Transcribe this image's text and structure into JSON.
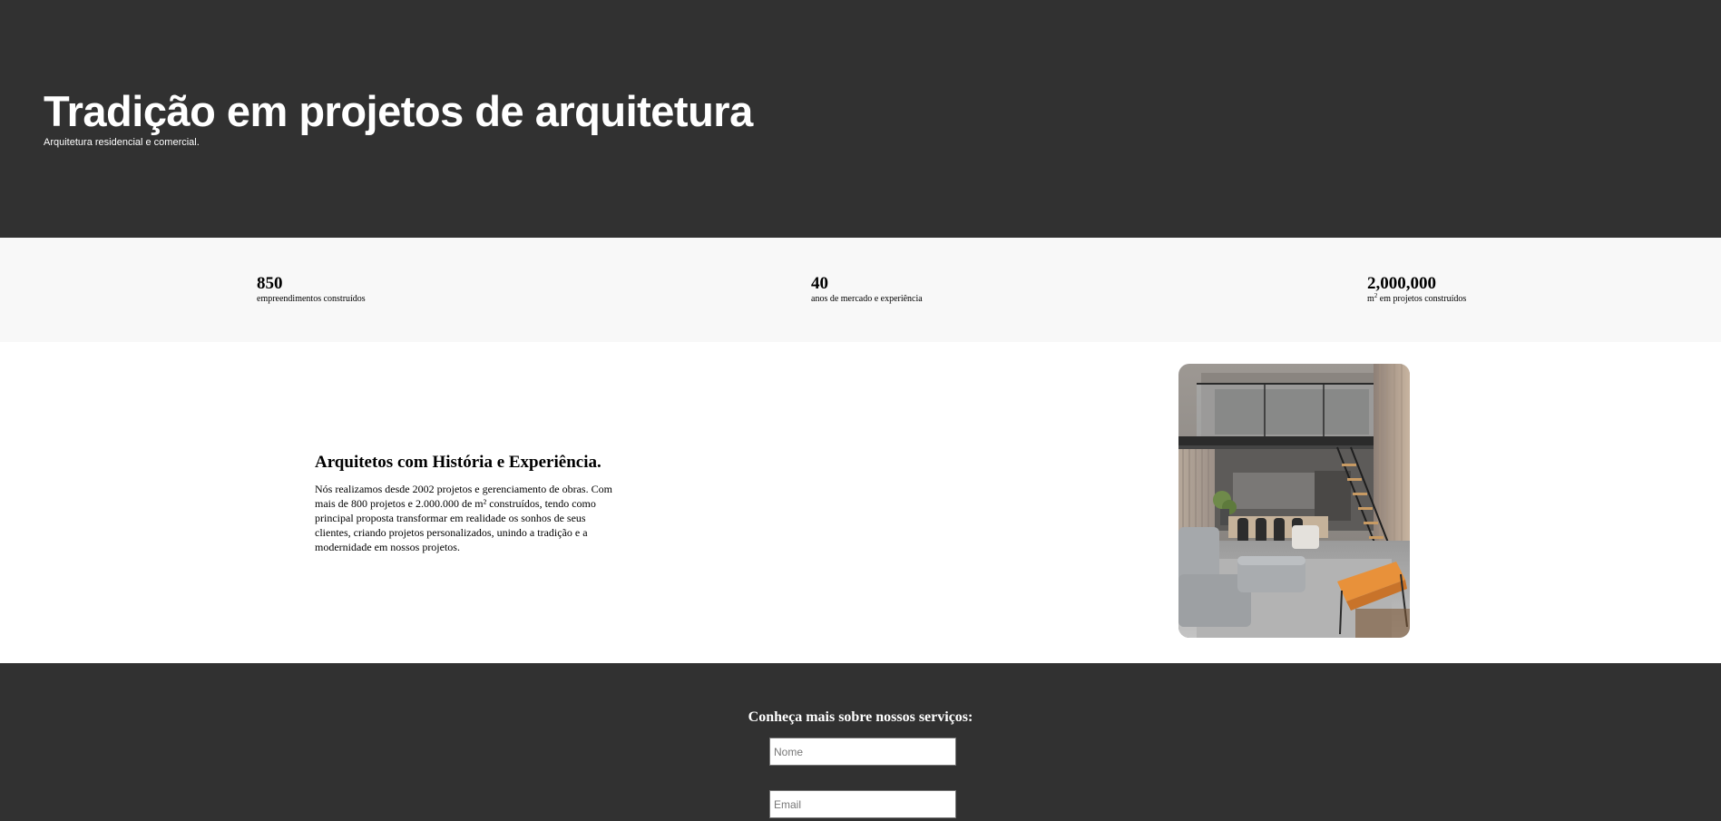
{
  "hero": {
    "title": "Tradição em projetos de arquitetura",
    "subtitle": "Arquitetura residencial e comercial."
  },
  "stats": [
    {
      "number": "850",
      "label": "empreendimentos construídos"
    },
    {
      "number": "40",
      "label": "anos de mercado e experiência"
    },
    {
      "number": "2,000,000",
      "label_prefix": "m",
      "label_sup": "2",
      "label_suffix": " em projetos construídos"
    }
  ],
  "about": {
    "title": "Arquitetos com História e Experiência.",
    "text": "Nós realizamos desde 2002 projetos e gerenciamento de obras. Com mais de 800 projetos e 2.000.000 de m² construídos, tendo como principal proposta transformar em realidade os sonhos de seus clientes, criando projetos personalizados, unindo a tradição e a modernidade em nossos projetos.",
    "image_icon": "loft-interior-photo"
  },
  "contact": {
    "title": "Conheça mais sobre nossos serviços:",
    "name_placeholder": "Nome",
    "email_placeholder": "Email"
  },
  "colors": {
    "dark_bg": "#313131",
    "stats_bg": "#f8f8f8",
    "accent_chair": "#e8913a"
  }
}
